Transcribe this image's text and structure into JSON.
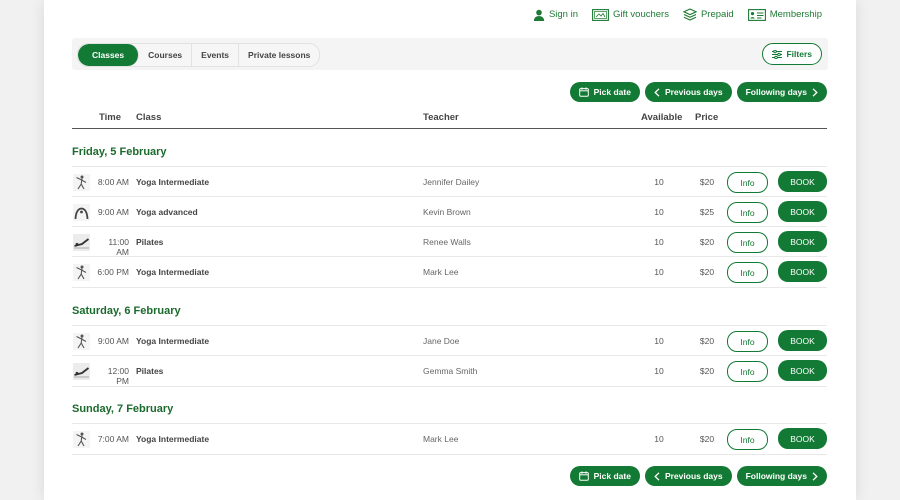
{
  "topnav": {
    "sign_in": "Sign in",
    "gift_vouchers": "Gift vouchers",
    "prepaid": "Prepaid",
    "membership": "Membership"
  },
  "tabs": [
    {
      "label": "Classes",
      "active": true
    },
    {
      "label": "Courses",
      "active": false
    },
    {
      "label": "Events",
      "active": false
    },
    {
      "label": "Private lessons",
      "active": false
    }
  ],
  "filters_label": "Filters",
  "nav": {
    "pick_date": "Pick date",
    "previous_days": "Previous days",
    "following_days": "Following days"
  },
  "columns": {
    "time": "Time",
    "class": "Class",
    "teacher": "Teacher",
    "available": "Available",
    "price": "Price"
  },
  "days": [
    {
      "label": "Friday, 5 February",
      "sessions": [
        {
          "time": "8:00 AM",
          "class": "Yoga Intermediate",
          "teacher": "Jennifer Dailey",
          "available": "10",
          "price": "$20",
          "icon": "yoga-pose-icon"
        },
        {
          "time": "9:00 AM",
          "class": "Yoga advanced",
          "teacher": "Kevin Brown",
          "available": "10",
          "price": "$25",
          "icon": "yoga-backbend-icon"
        },
        {
          "time": "11:00 AM",
          "class": "Pilates",
          "teacher": "Renee Walls",
          "available": "10",
          "price": "$20",
          "icon": "pilates-icon"
        },
        {
          "time": "6:00 PM",
          "class": "Yoga Intermediate",
          "teacher": "Mark Lee",
          "available": "10",
          "price": "$20",
          "icon": "yoga-pose-icon"
        }
      ]
    },
    {
      "label": "Saturday, 6 February",
      "sessions": [
        {
          "time": "9:00 AM",
          "class": "Yoga Intermediate",
          "teacher": "Jane Doe",
          "available": "10",
          "price": "$20",
          "icon": "yoga-pose-icon"
        },
        {
          "time": "12:00 PM",
          "class": "Pilates",
          "teacher": "Gemma Smith",
          "available": "10",
          "price": "$20",
          "icon": "pilates-icon"
        }
      ]
    },
    {
      "label": "Sunday, 7 February",
      "sessions": [
        {
          "time": "7:00 AM",
          "class": "Yoga Intermediate",
          "teacher": "Mark Lee",
          "available": "10",
          "price": "$20",
          "icon": "yoga-pose-icon"
        }
      ]
    }
  ],
  "row_buttons": {
    "info": "Info",
    "book": "BOOK"
  },
  "colors": {
    "brand_green": "#137a35",
    "day_heading": "#1b6a2d"
  }
}
